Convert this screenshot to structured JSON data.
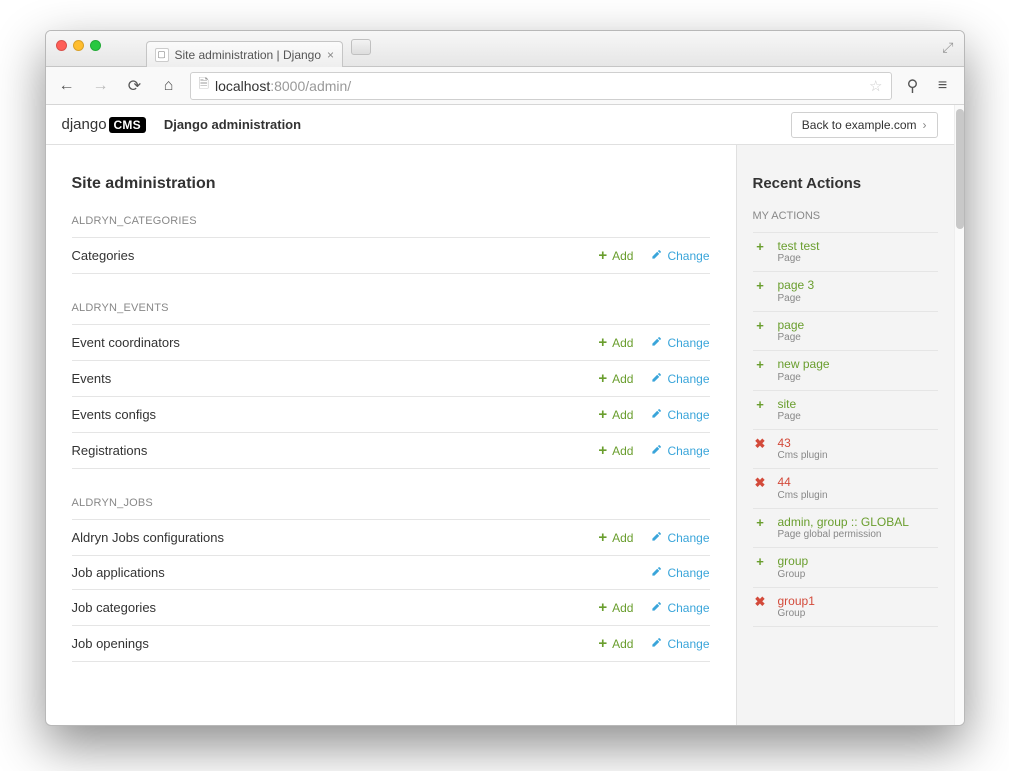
{
  "browser": {
    "tab_title": "Site administration | Django",
    "url_host": "localhost",
    "url_port": ":8000",
    "url_path": "/admin/"
  },
  "header": {
    "logo_text": "django",
    "logo_badge": "CMS",
    "admin_title": "Django administration",
    "back_label": "Back to example.com"
  },
  "page_title": "Site administration",
  "apps": [
    {
      "name": "ALDRYN_CATEGORIES",
      "models": [
        {
          "name": "Categories",
          "add": true,
          "change": true
        }
      ]
    },
    {
      "name": "ALDRYN_EVENTS",
      "models": [
        {
          "name": "Event coordinators",
          "add": true,
          "change": true
        },
        {
          "name": "Events",
          "add": true,
          "change": true
        },
        {
          "name": "Events configs",
          "add": true,
          "change": true
        },
        {
          "name": "Registrations",
          "add": true,
          "change": true
        }
      ]
    },
    {
      "name": "ALDRYN_JOBS",
      "models": [
        {
          "name": "Aldryn Jobs configurations",
          "add": true,
          "change": true
        },
        {
          "name": "Job applications",
          "add": false,
          "change": true
        },
        {
          "name": "Job categories",
          "add": true,
          "change": true
        },
        {
          "name": "Job openings",
          "add": true,
          "change": true
        }
      ]
    }
  ],
  "action_labels": {
    "add": "Add",
    "change": "Change"
  },
  "recent_actions": {
    "heading": "Recent Actions",
    "subheading": "MY ACTIONS",
    "items": [
      {
        "type": "add",
        "title": "test test",
        "subtitle": "Page"
      },
      {
        "type": "add",
        "title": "page 3",
        "subtitle": "Page"
      },
      {
        "type": "add",
        "title": "page",
        "subtitle": "Page"
      },
      {
        "type": "add",
        "title": "new page",
        "subtitle": "Page"
      },
      {
        "type": "add",
        "title": "site",
        "subtitle": "Page"
      },
      {
        "type": "del",
        "title": "43",
        "subtitle": "Cms plugin"
      },
      {
        "type": "del",
        "title": "44",
        "subtitle": "Cms plugin"
      },
      {
        "type": "add",
        "title": "admin, group :: GLOBAL",
        "subtitle": "Page global permission"
      },
      {
        "type": "add",
        "title": "group",
        "subtitle": "Group"
      },
      {
        "type": "del",
        "title": "group1",
        "subtitle": "Group"
      }
    ]
  }
}
